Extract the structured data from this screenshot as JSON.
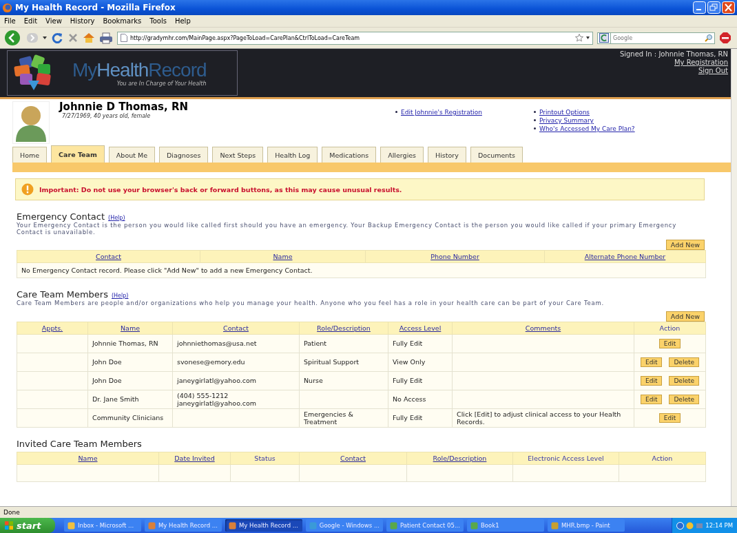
{
  "window": {
    "title": "My Health Record - Mozilla Firefox"
  },
  "menu": [
    "File",
    "Edit",
    "View",
    "History",
    "Bookmarks",
    "Tools",
    "Help"
  ],
  "toolbar": {
    "url": "http://gradymhr.com/MainPage.aspx?PageToLoad=CarePlan&CtrlToLoad=CareTeam",
    "search_placeholder": "Google"
  },
  "banner": {
    "logo": "My**Health**Record",
    "tagline": "You are In Charge of Your Health",
    "signed_in": "Signed In : Johnnie Thomas, RN",
    "links": [
      "My Registration",
      "Sign Out"
    ]
  },
  "profile": {
    "name": "Johnnie D Thomas, RN",
    "details": "7/27/1969, 40 years old, female",
    "links_left": [
      "Edit Johnnie's Registration"
    ],
    "links_right": [
      "Printout Options",
      "Privacy Summary",
      "Who's Accessed My Care Plan?"
    ]
  },
  "tabs": [
    {
      "label": "Home",
      "selected": false
    },
    {
      "label": "Care Team",
      "selected": true
    },
    {
      "label": "About Me",
      "selected": false
    },
    {
      "label": "Diagnoses",
      "selected": false
    },
    {
      "label": "Next Steps",
      "selected": false
    },
    {
      "label": "Health Log",
      "selected": false
    },
    {
      "label": "Medications",
      "selected": false
    },
    {
      "label": "Allergies",
      "selected": false
    },
    {
      "label": "History",
      "selected": false
    },
    {
      "label": "Documents",
      "selected": false
    }
  ],
  "warning": "Important: Do not use your browser's back or forward buttons, as this may cause unusual results.",
  "emergency": {
    "title": "Emergency Contact",
    "help": "(Help)",
    "description": "Your Emergency Contact is the person you would like called first should you have an emergency. Your Backup Emergency Contact is the person you would like called if your primary Emergency Contact is unavailable.",
    "add_button": "Add New",
    "columns": [
      {
        "label": "Contact",
        "link": true
      },
      {
        "label": "Name",
        "link": true
      },
      {
        "label": "Phone Number",
        "link": true
      },
      {
        "label": "Alternate Phone Number",
        "link": true
      }
    ],
    "empty_message": "No Emergency Contact record. Please click \"Add New\" to add a new Emergency Contact."
  },
  "care_team": {
    "title": "Care Team Members",
    "help": "(Help)",
    "description": "Care Team Members are people and/or organizations who help you manage your health. Anyone who you feel has a role in your health care can be part of your Care Team.",
    "add_button": "Add New",
    "columns": [
      {
        "label": "Appts.",
        "link": true
      },
      {
        "label": "Name",
        "link": true
      },
      {
        "label": "Contact",
        "link": true
      },
      {
        "label": "Role/Description",
        "link": true
      },
      {
        "label": "Access Level",
        "link": true
      },
      {
        "label": "Comments",
        "link": true
      },
      {
        "label": "Action",
        "link": false
      }
    ],
    "rows": [
      {
        "name": "Johnnie Thomas, RN",
        "contact_lines": [
          "johnniethomas@usa.net"
        ],
        "role": "Patient",
        "access": "Fully Edit",
        "actions": [
          "Edit"
        ]
      },
      {
        "name": "John Doe",
        "contact_lines": [
          "svonese@emory.edu"
        ],
        "role": "Spiritual Support",
        "access": "View Only",
        "actions": [
          "Edit",
          "Delete"
        ]
      },
      {
        "name": "John Doe",
        "contact_lines": [
          "janeygirlatl@yahoo.com"
        ],
        "role": "Nurse",
        "access": "Fully Edit",
        "actions": [
          "Edit",
          "Delete"
        ]
      },
      {
        "name": "Dr. Jane Smith",
        "contact_lines": [
          "(404) 555-1212",
          "janeygirlatl@yahoo.com"
        ],
        "access": "No Access",
        "actions": [
          "Edit",
          "Delete"
        ]
      },
      {
        "name": "Community Clinicians",
        "role": "Emergencies & Treatment",
        "access": "Fully Edit",
        "comments": "Click [Edit] to adjust clinical access to your Health Records.",
        "actions": [
          "Edit"
        ]
      }
    ]
  },
  "invited": {
    "title": "Invited Care Team Members",
    "columns": [
      {
        "label": "Name",
        "link": true
      },
      {
        "label": "Date Invited",
        "link": true
      },
      {
        "label": "Status",
        "link": false
      },
      {
        "label": "Contact",
        "link": true
      },
      {
        "label": "Role/Description",
        "link": true
      },
      {
        "label": "Electronic Access Level",
        "link": false
      },
      {
        "label": "Action",
        "link": false
      }
    ]
  },
  "status_bar": "Done",
  "taskbar": {
    "start": "start",
    "items": [
      {
        "label": "Inbox - Microsoft ...",
        "selected": false
      },
      {
        "label": "My Health Record ...",
        "selected": false
      },
      {
        "label": "My Health Record ...",
        "selected": true
      },
      {
        "label": "Google - Windows ...",
        "selected": false
      },
      {
        "label": "Patient Contact 05...",
        "selected": false
      },
      {
        "label": "Book1",
        "selected": false
      },
      {
        "label": "MHR.bmp - Paint",
        "selected": false
      }
    ],
    "clock": "12:14 PM"
  }
}
